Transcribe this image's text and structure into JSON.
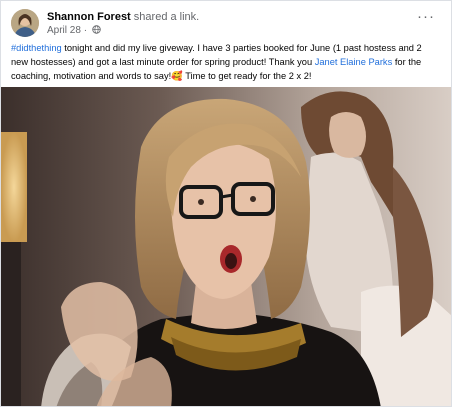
{
  "post": {
    "author": "Shannon Forest",
    "action": "shared a link.",
    "date": "April 28",
    "separator": "·",
    "more_label": "···",
    "body": {
      "hashtag": "#didthething",
      "text1": " tonight and did my live giveway.   I have 3 parties booked for June (1 past hostess and 2 new hostesses) and got a last minute order for spring product!  Thank you ",
      "mention": "Janet Elaine Parks",
      "text2": " for the coaching, motivation and words to say!",
      "emoji": "🥰",
      "text3": "   Time to get ready for the 2 x 2!"
    }
  },
  "icons": {
    "privacy": "globe-icon",
    "menu": "more-options-icon",
    "avatar": "profile-photo"
  },
  "colors": {
    "link": "#216fdb",
    "secondary_text": "#65676b",
    "border": "#dcdfe4"
  }
}
